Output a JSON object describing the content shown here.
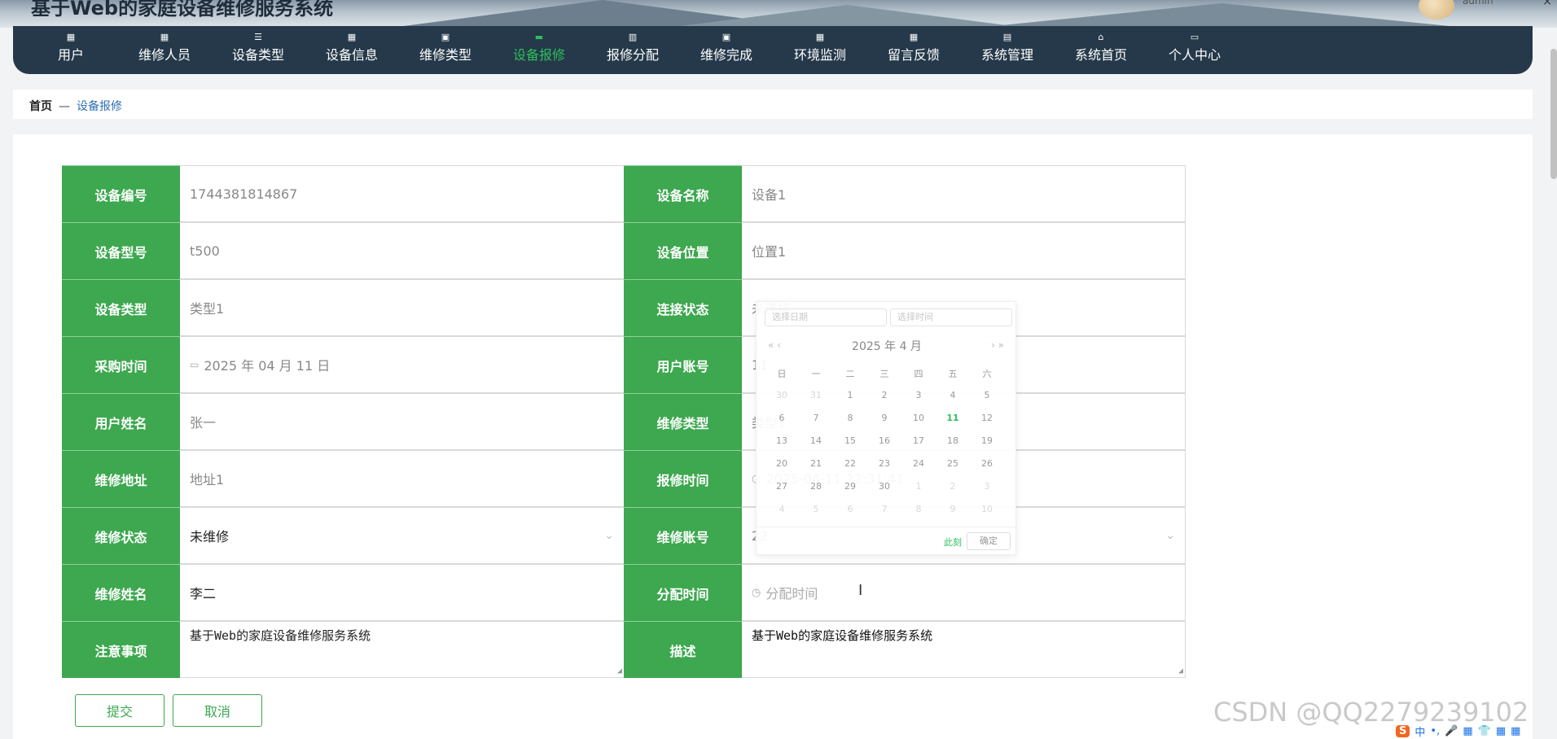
{
  "header": {
    "title": "基于Web的家庭设备维修服务系统",
    "username": "admin",
    "close_glyph": "×"
  },
  "nav": {
    "items": [
      {
        "label": "用户",
        "icon": "▦"
      },
      {
        "label": "维修人员",
        "icon": "▦"
      },
      {
        "label": "设备类型",
        "icon": "☰"
      },
      {
        "label": "设备信息",
        "icon": "▦"
      },
      {
        "label": "维修类型",
        "icon": "▣"
      },
      {
        "label": "设备报修",
        "icon": "▬"
      },
      {
        "label": "报修分配",
        "icon": "▥"
      },
      {
        "label": "维修完成",
        "icon": "▣"
      },
      {
        "label": "环境监测",
        "icon": "▦"
      },
      {
        "label": "留言反馈",
        "icon": "▦"
      },
      {
        "label": "系统管理",
        "icon": "▤"
      },
      {
        "label": "系统首页",
        "icon": "⌂"
      },
      {
        "label": "个人中心",
        "icon": "▭"
      }
    ],
    "active_index": 5
  },
  "breadcrumb": {
    "home": "首页",
    "separator": "—",
    "current": "设备报修"
  },
  "form": {
    "rows": [
      {
        "left_label": "设备编号",
        "left_value": "1744381814867",
        "right_label": "设备名称",
        "right_value": "设备1"
      },
      {
        "left_label": "设备型号",
        "left_value": "t500",
        "right_label": "设备位置",
        "right_value": "位置1"
      },
      {
        "left_label": "设备类型",
        "left_value": "类型1",
        "right_label": "连接状态",
        "right_value": "未连接"
      },
      {
        "left_label": "采购时间",
        "left_value": "2025 年 04 月 11 日",
        "right_label": "用户账号",
        "right_value": "11"
      },
      {
        "left_label": "用户姓名",
        "left_value": "张一",
        "right_label": "维修类型",
        "right_value": "类型1"
      },
      {
        "left_label": "维修地址",
        "left_value": "地址1",
        "right_label": "报修时间",
        "right_value": "2025-04-11 22:31:41"
      },
      {
        "left_label": "维修状态",
        "left_value": "未维修",
        "right_label": "维修账号",
        "right_value": "22"
      },
      {
        "left_label": "维修姓名",
        "left_value": "李二",
        "right_label": "分配时间",
        "right_value": "分配时间"
      },
      {
        "left_label": "注意事项",
        "left_value": "基于Web的家庭设备维修服务系统",
        "right_label": "描述",
        "right_value": "基于Web的家庭设备维修服务系统"
      }
    ],
    "submit_label": "提交",
    "cancel_label": "取消"
  },
  "date_picker": {
    "date_placeholder": "选择日期",
    "time_placeholder": "选择时间",
    "prev_glyph": "« ‹",
    "next_glyph": "› »",
    "title": "2025 年  4 月",
    "weekdays": [
      "日",
      "一",
      "二",
      "三",
      "四",
      "五",
      "六"
    ],
    "weeks": [
      [
        "30",
        "31",
        "1",
        "2",
        "3",
        "4",
        "5"
      ],
      [
        "6",
        "7",
        "8",
        "9",
        "10",
        "11",
        "12"
      ],
      [
        "13",
        "14",
        "15",
        "16",
        "17",
        "18",
        "19"
      ],
      [
        "20",
        "21",
        "22",
        "23",
        "24",
        "25",
        "26"
      ],
      [
        "27",
        "28",
        "29",
        "30",
        "1",
        "2",
        "3"
      ],
      [
        "4",
        "5",
        "6",
        "7",
        "8",
        "9",
        "10"
      ]
    ],
    "today": "11",
    "now_label": "此刻",
    "ok_label": "确定"
  },
  "watermark": "CSDN @QQ2279239102",
  "tray": {
    "s": "S",
    "items": [
      "中",
      "•,",
      "🎤",
      "▦",
      "👕",
      "▦",
      "▦"
    ]
  },
  "colors": {
    "nav_bg": "#25394a",
    "accent_green": "#3da84f",
    "active_nav": "#2fbf5a",
    "breadcrumb_link": "#2f6fb0"
  }
}
